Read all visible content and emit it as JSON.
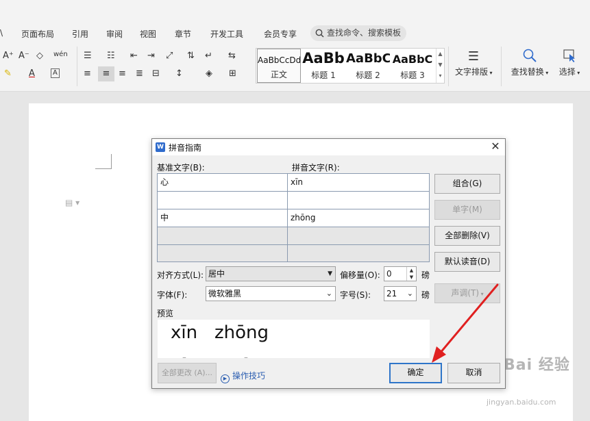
{
  "menu": {
    "items": [
      "\\",
      "页面布局",
      "引用",
      "审阅",
      "视图",
      "章节",
      "开发工具",
      "会员专享"
    ],
    "search_placeholder": "查找命令、搜索模板"
  },
  "ribbon": {
    "font_row": [
      "A⁺",
      "A⁻",
      "◇",
      "wén"
    ],
    "style_gallery": [
      {
        "sample": "AaBbCcDd",
        "label": "正文"
      },
      {
        "sample": "AaBb",
        "label": "标题 1"
      },
      {
        "sample": "AaBbC",
        "label": "标题 2"
      },
      {
        "sample": "AaBbC",
        "label": "标题 3"
      }
    ],
    "text_layout_label": "文字排版",
    "find_replace_label": "查找替换",
    "select_label": "选择"
  },
  "dialog": {
    "title": "拼音指南",
    "base_text_header": "基准文字(B):",
    "pinyin_text_header": "拼音文字(R):",
    "rows": [
      {
        "base": "心",
        "pinyin": "xīn",
        "enabled": true
      },
      {
        "base": "",
        "pinyin": "",
        "enabled": true
      },
      {
        "base": "中",
        "pinyin": "zhōng",
        "enabled": true
      },
      {
        "base": "",
        "pinyin": "",
        "enabled": false
      },
      {
        "base": "",
        "pinyin": "",
        "enabled": false
      }
    ],
    "buttons": {
      "combine": "组合(G)",
      "single_char": "单字(M)",
      "delete_all": "全部删除(V)",
      "default_reading": "默认读音(D)",
      "tone": "声调(T)",
      "change_all": "全部更改 (A)...",
      "ok": "确定",
      "cancel": "取消"
    },
    "alignment_label": "对齐方式(L):",
    "alignment_value": "居中",
    "offset_label": "偏移量(O):",
    "offset_value": "0",
    "offset_unit": "磅",
    "font_label": "字体(F):",
    "font_value": "微软雅黑",
    "size_label": "字号(S):",
    "size_value": "21",
    "size_unit": "磅",
    "preview_label": "预览",
    "preview_pinyin_1": "xīn",
    "preview_pinyin_2": "zhōng",
    "tips_link": "操作技巧"
  },
  "watermark": {
    "logo_text": "Bai 经验",
    "url": "jingyan.baidu.com"
  }
}
